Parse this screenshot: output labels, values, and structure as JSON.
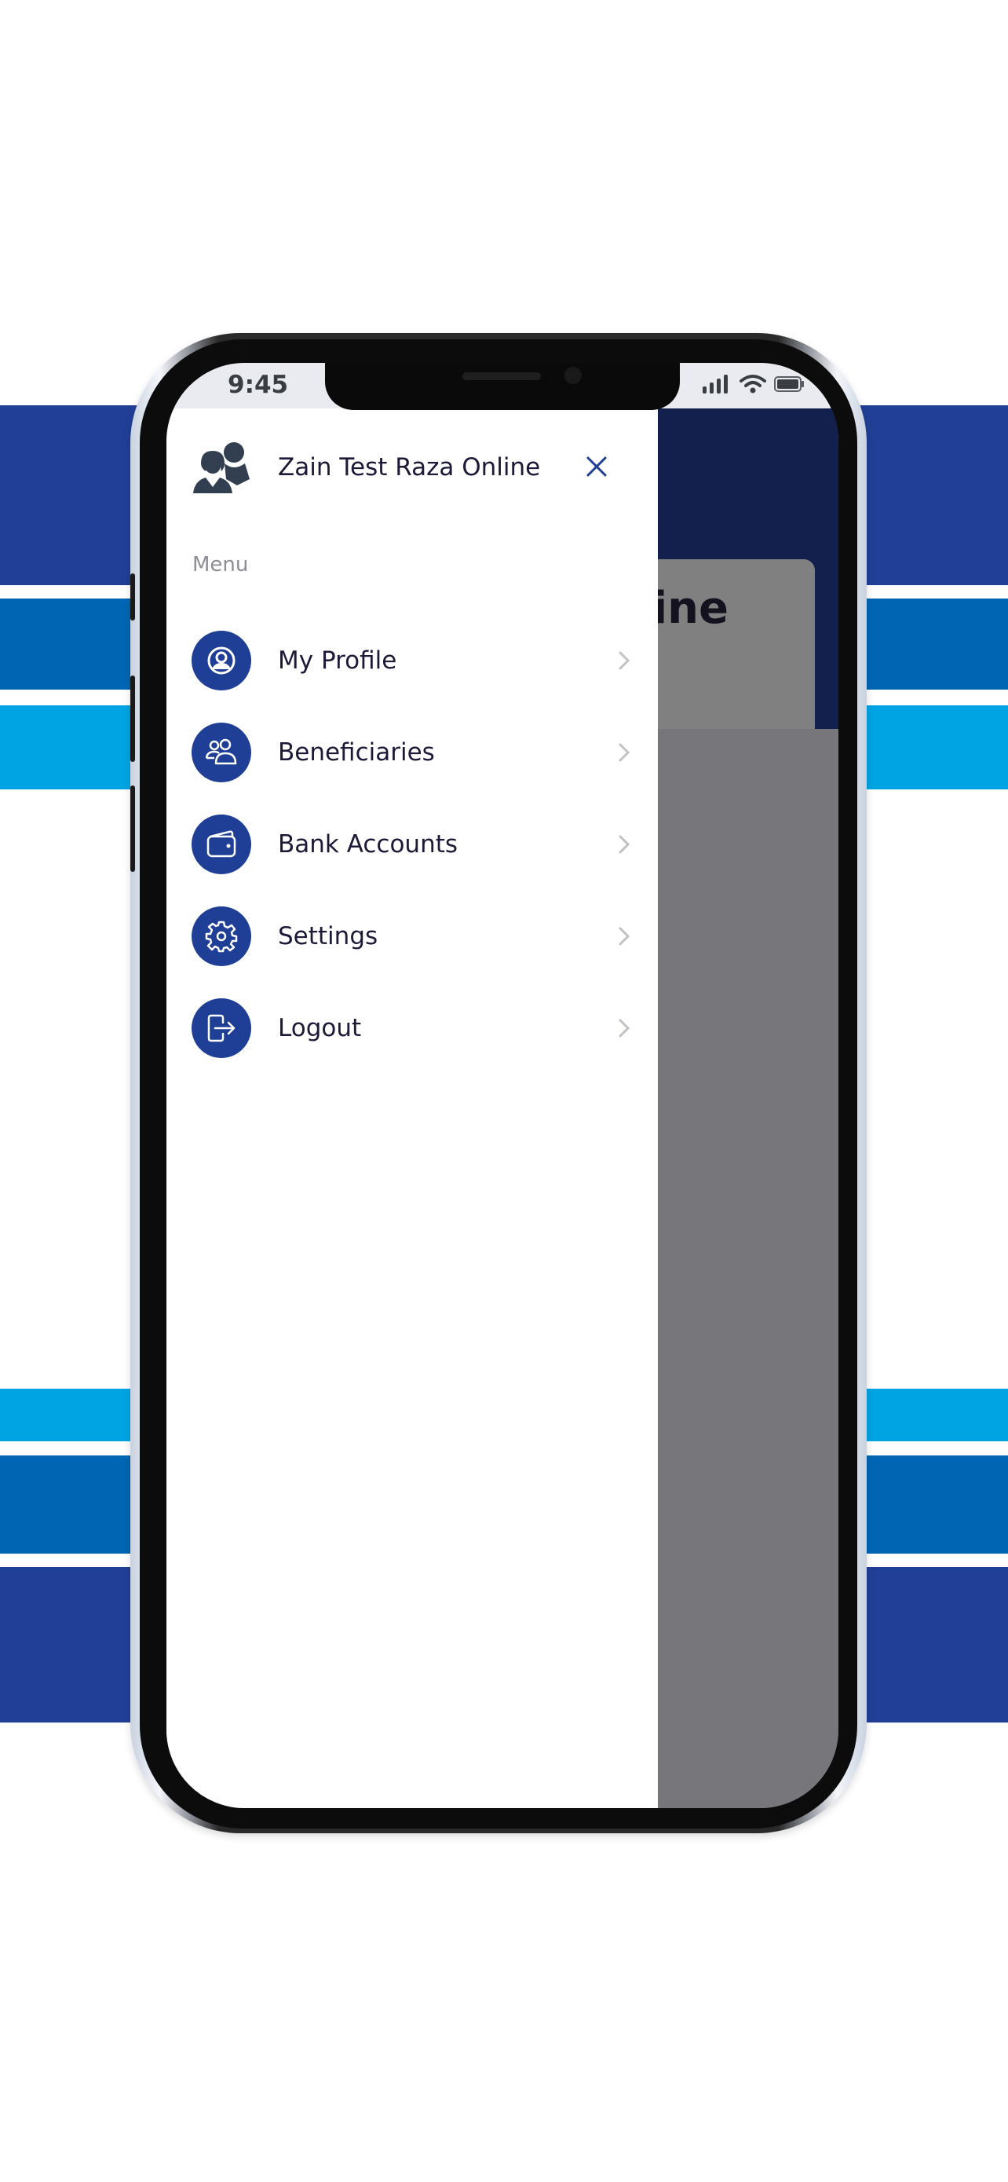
{
  "status_bar": {
    "time": "9:45",
    "icons": [
      "signal-icon",
      "wifi-icon",
      "battery-icon"
    ]
  },
  "drawer": {
    "user_name": "Zain Test Raza Online",
    "avatar_icon": "users-icon",
    "close_icon": "close-icon",
    "section_label": "Menu",
    "items": [
      {
        "label": "My Profile",
        "icon": "profile-icon"
      },
      {
        "label": "Beneficiaries",
        "icon": "beneficiaries-icon"
      },
      {
        "label": "Bank Accounts",
        "icon": "wallet-icon"
      },
      {
        "label": "Settings",
        "icon": "gear-icon"
      },
      {
        "label": "Logout",
        "icon": "logout-icon"
      }
    ]
  },
  "background_screen": {
    "card_title_visible": "ine"
  },
  "colors": {
    "brand_dark_blue": "#213f96",
    "brand_mid_blue": "#0066b3",
    "brand_light_blue": "#00a4e3",
    "menu_icon_bg": "#1f3f96",
    "header_navy": "#13204d",
    "overlay_gray": "#77767a",
    "text_dark": "#1c1a38",
    "text_muted": "#8e8d95"
  }
}
